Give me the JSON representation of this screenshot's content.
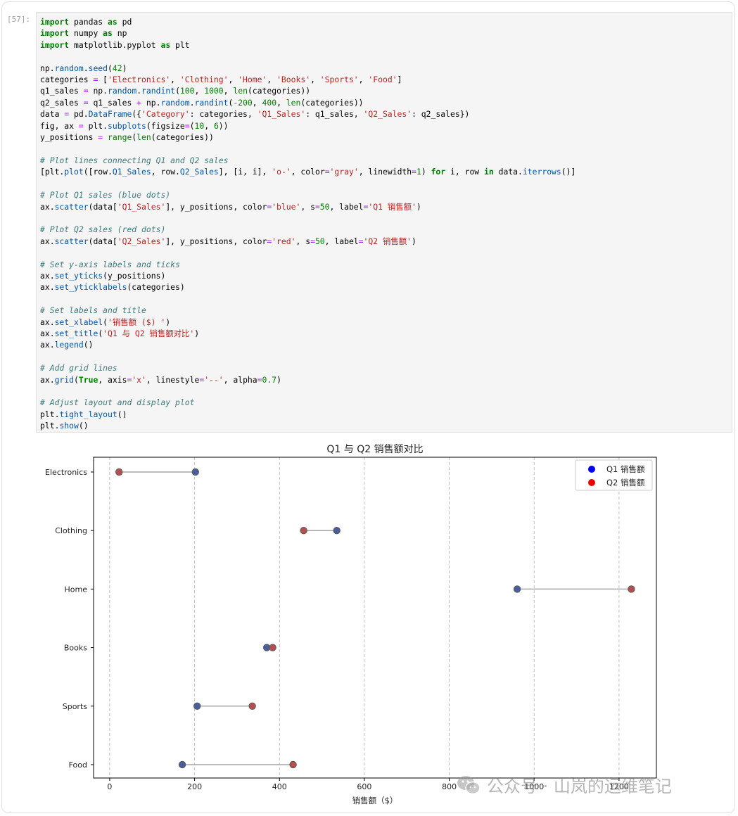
{
  "cell": {
    "prompt": "[57]:",
    "lines": [
      [
        [
          "k",
          "import"
        ],
        [
          "p",
          " pandas "
        ],
        [
          "k",
          "as"
        ],
        [
          "p",
          " pd"
        ]
      ],
      [
        [
          "k",
          "import"
        ],
        [
          "p",
          " numpy "
        ],
        [
          "k",
          "as"
        ],
        [
          "p",
          " np"
        ]
      ],
      [
        [
          "k",
          "import"
        ],
        [
          "p",
          " matplotlib.pyplot "
        ],
        [
          "k",
          "as"
        ],
        [
          "p",
          " plt"
        ]
      ],
      [],
      [
        [
          "p",
          "np."
        ],
        [
          "f",
          "random"
        ],
        [
          "p",
          "."
        ],
        [
          "f",
          "seed"
        ],
        [
          "p",
          "("
        ],
        [
          "n",
          "42"
        ],
        [
          "p",
          ")"
        ]
      ],
      [
        [
          "p",
          "categories "
        ],
        [
          "o",
          "="
        ],
        [
          "p",
          " ["
        ],
        [
          "s",
          "'Electronics'"
        ],
        [
          "p",
          ", "
        ],
        [
          "s",
          "'Clothing'"
        ],
        [
          "p",
          ", "
        ],
        [
          "s",
          "'Home'"
        ],
        [
          "p",
          ", "
        ],
        [
          "s",
          "'Books'"
        ],
        [
          "p",
          ", "
        ],
        [
          "s",
          "'Sports'"
        ],
        [
          "p",
          ", "
        ],
        [
          "s",
          "'Food'"
        ],
        [
          "p",
          "]"
        ]
      ],
      [
        [
          "p",
          "q1_sales "
        ],
        [
          "o",
          "="
        ],
        [
          "p",
          " np."
        ],
        [
          "f",
          "random"
        ],
        [
          "p",
          "."
        ],
        [
          "f",
          "randint"
        ],
        [
          "p",
          "("
        ],
        [
          "n",
          "100"
        ],
        [
          "p",
          ", "
        ],
        [
          "n",
          "1000"
        ],
        [
          "p",
          ", "
        ],
        [
          "n",
          "len"
        ],
        [
          "p",
          "(categories))"
        ]
      ],
      [
        [
          "p",
          "q2_sales "
        ],
        [
          "o",
          "="
        ],
        [
          "p",
          " q1_sales "
        ],
        [
          "o",
          "+"
        ],
        [
          "p",
          " np."
        ],
        [
          "f",
          "random"
        ],
        [
          "p",
          "."
        ],
        [
          "f",
          "randint"
        ],
        [
          "p",
          "("
        ],
        [
          "o",
          "-"
        ],
        [
          "n",
          "200"
        ],
        [
          "p",
          ", "
        ],
        [
          "n",
          "400"
        ],
        [
          "p",
          ", "
        ],
        [
          "n",
          "len"
        ],
        [
          "p",
          "(categories))"
        ]
      ],
      [
        [
          "p",
          "data "
        ],
        [
          "o",
          "="
        ],
        [
          "p",
          " pd."
        ],
        [
          "f",
          "DataFrame"
        ],
        [
          "p",
          "({"
        ],
        [
          "s",
          "'Category'"
        ],
        [
          "p",
          ": categories, "
        ],
        [
          "s",
          "'Q1_Sales'"
        ],
        [
          "p",
          ": q1_sales, "
        ],
        [
          "s",
          "'Q2_Sales'"
        ],
        [
          "p",
          ": q2_sales})"
        ]
      ],
      [
        [
          "p",
          "fig, ax "
        ],
        [
          "o",
          "="
        ],
        [
          "p",
          " plt."
        ],
        [
          "f",
          "subplots"
        ],
        [
          "p",
          "(figsize"
        ],
        [
          "o",
          "="
        ],
        [
          "p",
          "("
        ],
        [
          "n",
          "10"
        ],
        [
          "p",
          ", "
        ],
        [
          "n",
          "6"
        ],
        [
          "p",
          "))"
        ]
      ],
      [
        [
          "p",
          "y_positions "
        ],
        [
          "o",
          "="
        ],
        [
          "p",
          " "
        ],
        [
          "n",
          "range"
        ],
        [
          "p",
          "("
        ],
        [
          "n",
          "len"
        ],
        [
          "p",
          "(categories))"
        ]
      ],
      [],
      [
        [
          "c",
          "# Plot lines connecting Q1 and Q2 sales"
        ]
      ],
      [
        [
          "p",
          "[plt."
        ],
        [
          "f",
          "plot"
        ],
        [
          "p",
          "([row."
        ],
        [
          "f",
          "Q1_Sales"
        ],
        [
          "p",
          ", row."
        ],
        [
          "f",
          "Q2_Sales"
        ],
        [
          "p",
          "], [i, i], "
        ],
        [
          "s",
          "'o-'"
        ],
        [
          "p",
          ", color"
        ],
        [
          "o",
          "="
        ],
        [
          "s",
          "'gray'"
        ],
        [
          "p",
          ", linewidth"
        ],
        [
          "o",
          "="
        ],
        [
          "n",
          "1"
        ],
        [
          "p",
          ") "
        ],
        [
          "k",
          "for"
        ],
        [
          "p",
          " i, row "
        ],
        [
          "k",
          "in"
        ],
        [
          "p",
          " data."
        ],
        [
          "f",
          "iterrows"
        ],
        [
          "p",
          "()]"
        ]
      ],
      [],
      [
        [
          "c",
          "# Plot Q1 sales (blue dots)"
        ]
      ],
      [
        [
          "p",
          "ax."
        ],
        [
          "f",
          "scatter"
        ],
        [
          "p",
          "(data["
        ],
        [
          "s",
          "'Q1_Sales'"
        ],
        [
          "p",
          "], y_positions, color"
        ],
        [
          "o",
          "="
        ],
        [
          "s",
          "'blue'"
        ],
        [
          "p",
          ", s"
        ],
        [
          "o",
          "="
        ],
        [
          "n",
          "50"
        ],
        [
          "p",
          ", label"
        ],
        [
          "o",
          "="
        ],
        [
          "s",
          "'Q1 销售额'"
        ],
        [
          "p",
          ")"
        ]
      ],
      [],
      [
        [
          "c",
          "# Plot Q2 sales (red dots)"
        ]
      ],
      [
        [
          "p",
          "ax."
        ],
        [
          "f",
          "scatter"
        ],
        [
          "p",
          "(data["
        ],
        [
          "s",
          "'Q2_Sales'"
        ],
        [
          "p",
          "], y_positions, color"
        ],
        [
          "o",
          "="
        ],
        [
          "s",
          "'red'"
        ],
        [
          "p",
          ", s"
        ],
        [
          "o",
          "="
        ],
        [
          "n",
          "50"
        ],
        [
          "p",
          ", label"
        ],
        [
          "o",
          "="
        ],
        [
          "s",
          "'Q2 销售额'"
        ],
        [
          "p",
          ")"
        ]
      ],
      [],
      [
        [
          "c",
          "# Set y-axis labels and ticks"
        ]
      ],
      [
        [
          "p",
          "ax."
        ],
        [
          "f",
          "set_yticks"
        ],
        [
          "p",
          "(y_positions)"
        ]
      ],
      [
        [
          "p",
          "ax."
        ],
        [
          "f",
          "set_yticklabels"
        ],
        [
          "p",
          "(categories)"
        ]
      ],
      [],
      [
        [
          "c",
          "# Set labels and title"
        ]
      ],
      [
        [
          "p",
          "ax."
        ],
        [
          "f",
          "set_xlabel"
        ],
        [
          "p",
          "("
        ],
        [
          "s",
          "'销售额 ($) '"
        ],
        [
          "p",
          ")"
        ]
      ],
      [
        [
          "p",
          "ax."
        ],
        [
          "f",
          "set_title"
        ],
        [
          "p",
          "("
        ],
        [
          "s",
          "'Q1 与 Q2 销售额对比'"
        ],
        [
          "p",
          ")"
        ]
      ],
      [
        [
          "p",
          "ax."
        ],
        [
          "f",
          "legend"
        ],
        [
          "p",
          "()"
        ]
      ],
      [],
      [
        [
          "c",
          "# Add grid lines"
        ]
      ],
      [
        [
          "p",
          "ax."
        ],
        [
          "f",
          "grid"
        ],
        [
          "p",
          "("
        ],
        [
          "k",
          "True"
        ],
        [
          "p",
          ", axis"
        ],
        [
          "o",
          "="
        ],
        [
          "s",
          "'x'"
        ],
        [
          "p",
          ", linestyle"
        ],
        [
          "o",
          "="
        ],
        [
          "s",
          "'--'"
        ],
        [
          "p",
          ", alpha"
        ],
        [
          "o",
          "="
        ],
        [
          "n",
          "0.7"
        ],
        [
          "p",
          ")"
        ]
      ],
      [],
      [
        [
          "c",
          "# Adjust layout and display plot"
        ]
      ],
      [
        [
          "p",
          "plt."
        ],
        [
          "f",
          "tight_layout"
        ],
        [
          "p",
          "()"
        ]
      ],
      [
        [
          "p",
          "plt."
        ],
        [
          "f",
          "show"
        ],
        [
          "p",
          "()"
        ]
      ]
    ]
  },
  "chart_data": {
    "type": "scatter",
    "title": "Q1 与 Q2 销售额对比",
    "xlabel": "销售额（$）",
    "ylabel": "",
    "categories": [
      "Electronics",
      "Clothing",
      "Home",
      "Books",
      "Sports",
      "Food"
    ],
    "xlim": [
      -38,
      1288
    ],
    "xticks": [
      0,
      200,
      400,
      600,
      800,
      1000,
      1200
    ],
    "grid": "x, dashed",
    "legend_position": "top-right",
    "series": [
      {
        "name": "Q1 销售额",
        "color": "#4a5f9a",
        "values": [
          202,
          535,
          960,
          370,
          206,
          171
        ]
      },
      {
        "name": "Q2 销售额",
        "color": "#b05050",
        "values": [
          22,
          457,
          1229,
          384,
          336,
          432
        ]
      }
    ],
    "connector_color": "#a6a6a6"
  },
  "watermark": {
    "text": "公众号 · 山岚的运维笔记",
    "icon": "wechat-icon"
  }
}
